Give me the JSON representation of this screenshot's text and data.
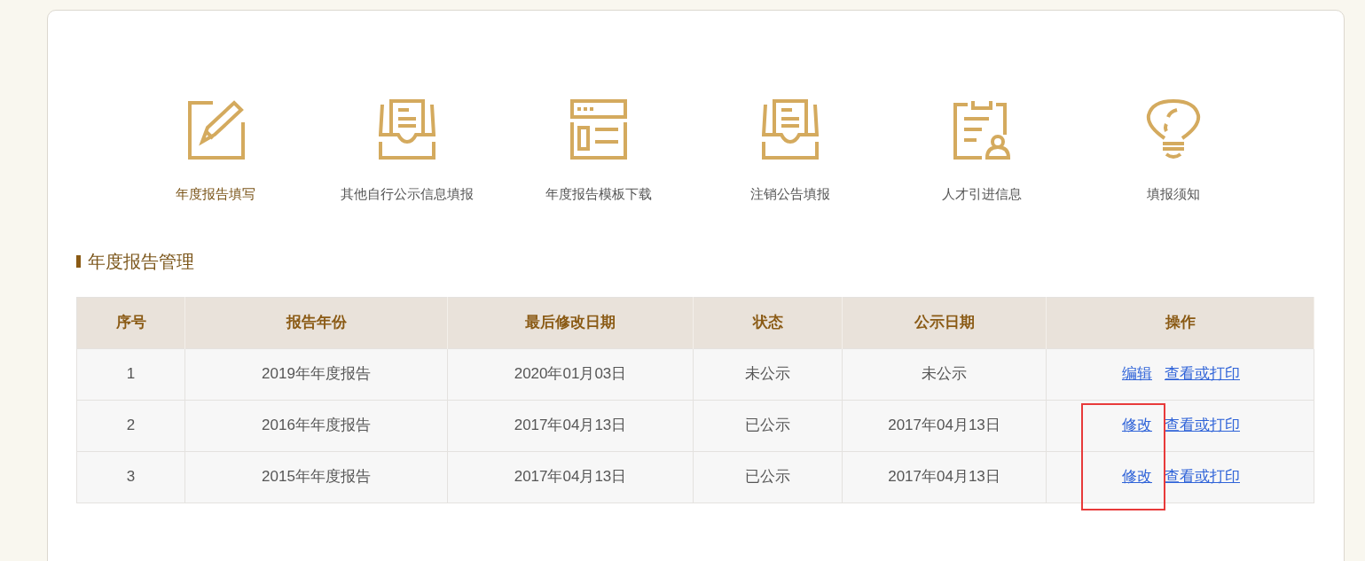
{
  "shortcuts": [
    {
      "kind": "edit",
      "label": "年度报告填写",
      "selected": true
    },
    {
      "kind": "inbox",
      "label": "其他自行公示信息填报",
      "selected": false
    },
    {
      "kind": "template",
      "label": "年度报告模板下载",
      "selected": false
    },
    {
      "kind": "inbox",
      "label": "注销公告填报",
      "selected": false
    },
    {
      "kind": "talent",
      "label": "人才引进信息",
      "selected": false
    },
    {
      "kind": "bulb",
      "label": "填报须知",
      "selected": false
    }
  ],
  "section_title": "年度报告管理",
  "table": {
    "columns": [
      "序号",
      "报告年份",
      "最后修改日期",
      "状态",
      "公示日期",
      "操作"
    ],
    "rows": [
      {
        "cells": [
          "1",
          "2019年年度报告",
          "2020年01月03日",
          "未公示",
          "未公示"
        ],
        "actions": [
          "编辑",
          "查看或打印"
        ],
        "highlighted": false
      },
      {
        "cells": [
          "2",
          "2016年年度报告",
          "2017年04月13日",
          "已公示",
          "2017年04月13日"
        ],
        "actions": [
          "修改",
          "查看或打印"
        ],
        "highlighted": true
      },
      {
        "cells": [
          "3",
          "2015年年度报告",
          "2017年04月13日",
          "已公示",
          "2017年04月13日"
        ],
        "actions": [
          "修改",
          "查看或打印"
        ],
        "highlighted": true
      }
    ]
  }
}
